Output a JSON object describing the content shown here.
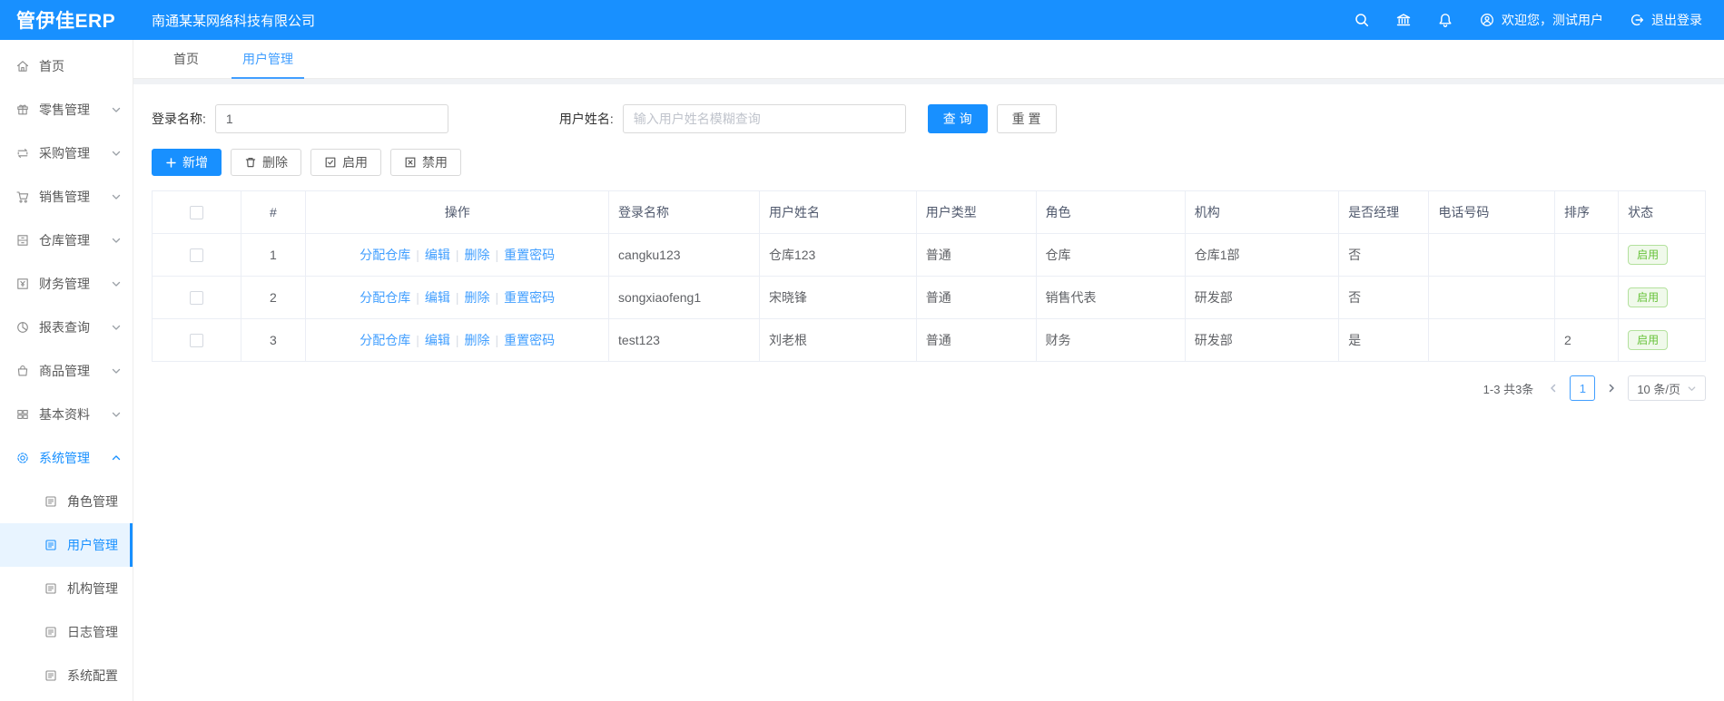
{
  "colors": {
    "header_blue": "#1890ff",
    "link_blue": "#409eff",
    "success_green": "#67c23a"
  },
  "header": {
    "logo": "管伊佳ERP",
    "company": "南通某某网络科技有限公司",
    "welcome": "欢迎您，测试用户",
    "logout": "退出登录"
  },
  "sidebar": {
    "items": [
      {
        "id": "home",
        "label": "首页",
        "icon": "home-icon"
      },
      {
        "id": "retail",
        "label": "零售管理",
        "icon": "retail-icon",
        "chevron": "down"
      },
      {
        "id": "purchase",
        "label": "采购管理",
        "icon": "purchase-icon",
        "chevron": "down"
      },
      {
        "id": "sales",
        "label": "销售管理",
        "icon": "sales-icon",
        "chevron": "down"
      },
      {
        "id": "warehouse",
        "label": "仓库管理",
        "icon": "warehouse-icon",
        "chevron": "down"
      },
      {
        "id": "finance",
        "label": "财务管理",
        "icon": "finance-icon",
        "chevron": "down"
      },
      {
        "id": "report",
        "label": "报表查询",
        "icon": "report-icon",
        "chevron": "down"
      },
      {
        "id": "goods",
        "label": "商品管理",
        "icon": "goods-icon",
        "chevron": "down"
      },
      {
        "id": "basic",
        "label": "基本资料",
        "icon": "basic-icon",
        "chevron": "down"
      },
      {
        "id": "system",
        "label": "系统管理",
        "icon": "system-icon",
        "chevron": "up",
        "active": true
      },
      {
        "id": "role",
        "label": "角色管理",
        "icon": "doc-icon",
        "sub": true
      },
      {
        "id": "user",
        "label": "用户管理",
        "icon": "doc-icon",
        "sub": true,
        "selected": true
      },
      {
        "id": "org",
        "label": "机构管理",
        "icon": "doc-icon",
        "sub": true
      },
      {
        "id": "log",
        "label": "日志管理",
        "icon": "doc-icon",
        "sub": true
      },
      {
        "id": "config",
        "label": "系统配置",
        "icon": "doc-icon",
        "sub": true
      }
    ]
  },
  "tabs": [
    {
      "id": "home",
      "label": "首页"
    },
    {
      "id": "user-management",
      "label": "用户管理",
      "active": true
    }
  ],
  "search": {
    "login_label": "登录名称:",
    "login_value": "1",
    "name_label": "用户姓名:",
    "name_placeholder": "输入用户姓名模糊查询",
    "query": "查 询",
    "reset": "重 置"
  },
  "toolbar": {
    "add": "新增",
    "delete": "删除",
    "enable": "启用",
    "disable": "禁用"
  },
  "table": {
    "headers": [
      "#",
      "操作",
      "登录名称",
      "用户姓名",
      "用户类型",
      "角色",
      "机构",
      "是否经理",
      "电话号码",
      "排序",
      "状态"
    ],
    "actions": [
      {
        "id": "assign-warehouse",
        "label": "分配仓库"
      },
      {
        "id": "edit",
        "label": "编辑"
      },
      {
        "id": "delete",
        "label": "删除"
      },
      {
        "id": "reset-password",
        "label": "重置密码"
      }
    ],
    "rows": [
      {
        "index": "1",
        "login": "cangku123",
        "name": "仓库123",
        "type": "普通",
        "role": "仓库",
        "org": "仓库1部",
        "manager": "否",
        "phone": "",
        "sort": "",
        "status": "启用"
      },
      {
        "index": "2",
        "login": "songxiaofeng1",
        "name": "宋晓锋",
        "type": "普通",
        "role": "销售代表",
        "org": "研发部",
        "manager": "否",
        "phone": "",
        "sort": "",
        "status": "启用"
      },
      {
        "index": "3",
        "login": "test123",
        "name": "刘老根",
        "type": "普通",
        "role": "财务",
        "org": "研发部",
        "manager": "是",
        "phone": "",
        "sort": "2",
        "status": "启用"
      }
    ]
  },
  "pagination": {
    "total": "1-3 共3条",
    "page": "1",
    "per_page": "10 条/页"
  }
}
